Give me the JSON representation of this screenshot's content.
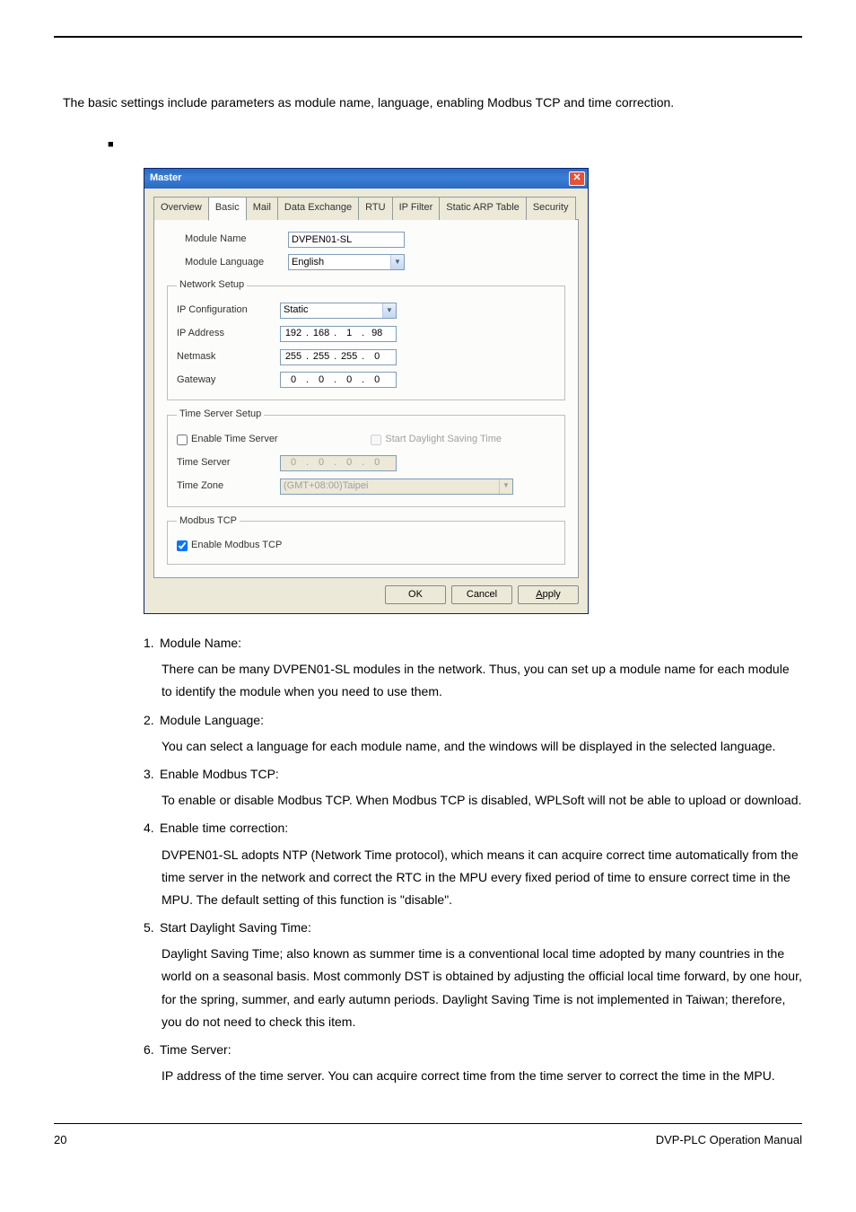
{
  "intro": "The basic settings include parameters as module name, language, enabling Modbus TCP and time correction.",
  "dialog": {
    "title": "Master",
    "tabs": [
      "Overview",
      "Basic",
      "Mail",
      "Data Exchange",
      "RTU",
      "IP Filter",
      "Static ARP Table",
      "Security"
    ],
    "active_tab": 1,
    "module_name_label": "Module Name",
    "module_name_value": "DVPEN01-SL",
    "module_lang_label": "Module Language",
    "module_lang_value": "English",
    "network_setup_legend": "Network Setup",
    "ip_config_label": "IP Configuration",
    "ip_config_value": "Static",
    "ip_addr_label": "IP Address",
    "ip_addr": [
      "192",
      "168",
      "1",
      "98"
    ],
    "netmask_label": "Netmask",
    "netmask": [
      "255",
      "255",
      "255",
      "0"
    ],
    "gateway_label": "Gateway",
    "gateway": [
      "0",
      "0",
      "0",
      "0"
    ],
    "time_server_legend": "Time Server Setup",
    "enable_time_server_label": "Enable Time Server",
    "start_dst_label": "Start Daylight Saving Time",
    "time_server_label": "Time Server",
    "time_server_ip": [
      "0",
      "0",
      "0",
      "0"
    ],
    "time_zone_label": "Time Zone",
    "time_zone_value": "(GMT+08:00)Taipei",
    "modbus_legend": "Modbus TCP",
    "enable_modbus_label": "Enable Modbus TCP",
    "buttons": {
      "ok": "OK",
      "cancel": "Cancel",
      "apply_u": "A",
      "apply_rest": "pply"
    }
  },
  "items": [
    {
      "n": "1.",
      "title": "Module Name:",
      "body": "There can be many DVPEN01-SL modules in the network. Thus, you can set up a module name for each module to identify the module when you need to use them."
    },
    {
      "n": "2.",
      "title": "Module Language:",
      "body": "You can select a language for each module name, and the windows will be displayed in the selected language."
    },
    {
      "n": "3.",
      "title": "Enable Modbus TCP:",
      "body": "To enable or disable Modbus TCP. When Modbus TCP is disabled, WPLSoft will not be able to upload or download."
    },
    {
      "n": "4.",
      "title": "Enable time correction:",
      "body": "DVPEN01-SL adopts NTP (Network Time protocol), which means it can acquire correct time automatically from the time server in the network and correct the RTC in the MPU every fixed period of time to ensure correct time in the MPU. The default setting of this function is \"disable\"."
    },
    {
      "n": "5.",
      "title": "Start Daylight Saving Time:",
      "body": "Daylight Saving Time; also known as summer time is a conventional local time adopted by many countries in the world on a seasonal basis. Most commonly DST is obtained by adjusting the official local time forward, by one hour, for the spring, summer, and early autumn periods. Daylight Saving Time is not implemented in Taiwan; therefore, you do not need to check this item."
    },
    {
      "n": "6.",
      "title": "Time Server:",
      "body": "IP address of the time server. You can acquire correct time from the time server to correct the time in the MPU."
    }
  ],
  "footer": {
    "page": "20",
    "manual": "DVP-PLC Operation Manual"
  }
}
